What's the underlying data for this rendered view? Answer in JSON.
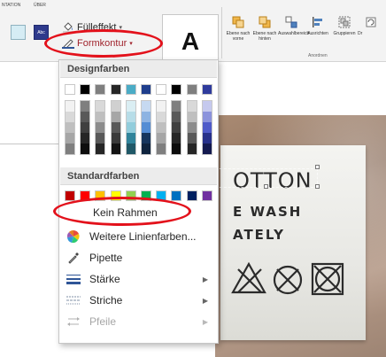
{
  "ribbon": {
    "tabs": [
      "NTATION",
      "ÜBER"
    ],
    "style_swatch_text": "Abc",
    "fill_effect_label": "Fülleffekt",
    "shape_outline_label": "Formkontur",
    "wordart_letter": "A",
    "arrange": {
      "buttons": [
        {
          "label": "Ebene nach vorne"
        },
        {
          "label": "Ebene nach hinten"
        },
        {
          "label": "Auswahlbereich"
        },
        {
          "label": "Ausrichten"
        },
        {
          "label": "Gruppieren"
        },
        {
          "label": "Dr"
        }
      ],
      "group_label": "Anordnen"
    }
  },
  "menu": {
    "theme_colors_header": "Designfarben",
    "standard_colors_header": "Standardfarben",
    "theme_colors": {
      "top_row": [
        "#ffffff",
        "#000000",
        "#7f7f7f",
        "#262626",
        "#4bacc6",
        "#1f3e8c",
        "#ffffff",
        "#000000",
        "#7f7f7f",
        "#2f3b9c"
      ],
      "shade_columns": [
        [
          "#f2f2f2",
          "#d9d9d9",
          "#bfbfbf",
          "#a6a6a6",
          "#7f7f7f"
        ],
        [
          "#7f7f7f",
          "#595959",
          "#404040",
          "#262626",
          "#0d0d0d"
        ],
        [
          "#d9d9d9",
          "#bfbfbf",
          "#8c8c8c",
          "#595959",
          "#262626"
        ],
        [
          "#d0d0d0",
          "#a6a6a6",
          "#595959",
          "#3a3a3a",
          "#141414"
        ],
        [
          "#daeef3",
          "#b7dde8",
          "#92cddc",
          "#31849b",
          "#205867"
        ],
        [
          "#c6d9f1",
          "#8db3e2",
          "#548dd4",
          "#17365d",
          "#0f243e"
        ],
        [
          "#f2f2f2",
          "#d9d9d9",
          "#bfbfbf",
          "#a6a6a6",
          "#7f7f7f"
        ],
        [
          "#7f7f7f",
          "#595959",
          "#404040",
          "#262626",
          "#0d0d0d"
        ],
        [
          "#d9d9d9",
          "#bfbfbf",
          "#8c8c8c",
          "#595959",
          "#262626"
        ],
        [
          "#c5c9ee",
          "#8b93dc",
          "#4f5bc9",
          "#27318a",
          "#141a4f"
        ]
      ]
    },
    "standard_colors": [
      "#c00000",
      "#ff0000",
      "#ffc000",
      "#ffff00",
      "#92d050",
      "#00b050",
      "#00b0f0",
      "#0070c0",
      "#002060",
      "#7030a0"
    ],
    "items": {
      "no_outline": "Kein Rahmen",
      "more_colors": "Weitere Linienfarben...",
      "eyedropper": "Pipette",
      "weight": "Stärke",
      "dashes": "Striche",
      "arrows": "Pfeile"
    }
  },
  "photo": {
    "label_lines": [
      "OTTON",
      "E WASH",
      "ATELY"
    ]
  },
  "colors": {
    "annotation_red": "#e3111b",
    "ribbon_bg": "#f3f3f3"
  }
}
